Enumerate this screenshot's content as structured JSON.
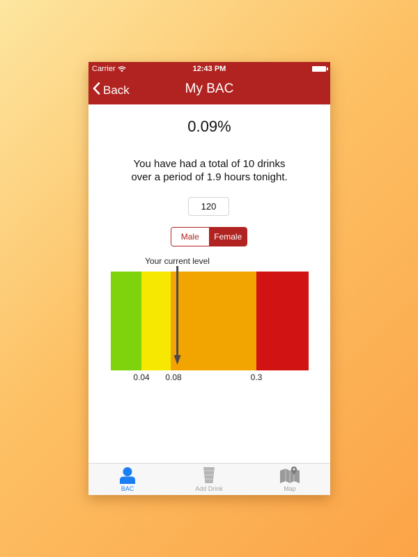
{
  "status_bar": {
    "carrier": "Carrier",
    "time": "12:43 PM"
  },
  "nav": {
    "back_label": "Back",
    "title": "My BAC"
  },
  "bac": {
    "value": "0.09%",
    "summary_line1": "You have had a total of 10 drinks",
    "summary_line2": "over a period of 1.9 hours tonight."
  },
  "weight_input": {
    "value": "120"
  },
  "gender_toggle": {
    "options": [
      "Male",
      "Female"
    ],
    "selected": "Female"
  },
  "level_indicator": {
    "label": "Your current level",
    "current_bac": 0.09
  },
  "bac_zones": {
    "thresholds": [
      {
        "label": "0.04",
        "value": 0.04
      },
      {
        "label": "0.08",
        "value": 0.08
      },
      {
        "label": "0.3",
        "value": 0.3
      }
    ],
    "colors": [
      "#7fd30c",
      "#f6e800",
      "#f2a500",
      "#d21313"
    ]
  },
  "tabbar": {
    "tabs": [
      {
        "label": "BAC",
        "icon": "person-icon",
        "active": true
      },
      {
        "label": "Add Drink",
        "icon": "cup-icon",
        "active": false
      },
      {
        "label": "Map",
        "icon": "map-icon",
        "active": false
      }
    ],
    "active_color": "#1b7ef3",
    "inactive_color": "#a3a3a3"
  },
  "colors": {
    "brand": "#b02320",
    "background_gradient_start": "#fde6a0",
    "background_gradient_end": "#fca347"
  }
}
